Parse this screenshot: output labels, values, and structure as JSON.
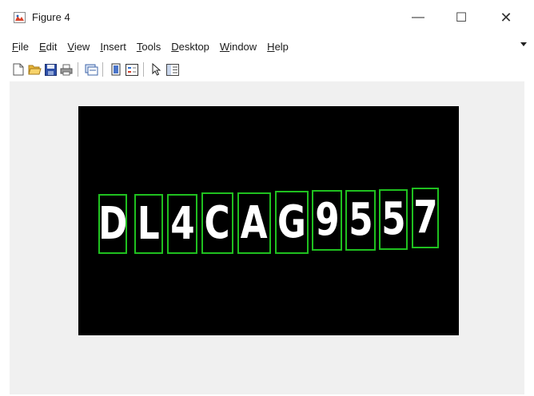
{
  "window": {
    "title": "Figure 4",
    "minimize_symbol": "—",
    "maximize_symbol": "☐",
    "close_symbol": "✕"
  },
  "menu": {
    "items": [
      {
        "mnemonic": "F",
        "rest": "ile"
      },
      {
        "mnemonic": "E",
        "rest": "dit"
      },
      {
        "mnemonic": "V",
        "rest": "iew"
      },
      {
        "mnemonic": "I",
        "rest": "nsert"
      },
      {
        "mnemonic": "T",
        "rest": "ools"
      },
      {
        "mnemonic": "D",
        "rest": "esktop"
      },
      {
        "mnemonic": "W",
        "rest": "indow"
      },
      {
        "mnemonic": "H",
        "rest": "elp"
      }
    ]
  },
  "toolbar": {
    "icons": [
      "new-figure-icon",
      "open-file-icon",
      "save-icon",
      "print-icon",
      "link-plot-icon",
      "colorbar-icon",
      "legend-icon",
      "pointer-icon",
      "property-editor-icon"
    ]
  },
  "plot": {
    "background": "#000000",
    "box_color": "#1fc01f",
    "characters": [
      "D",
      "L",
      "4",
      "C",
      "A",
      "G",
      "9",
      "5",
      "5",
      "7"
    ]
  }
}
